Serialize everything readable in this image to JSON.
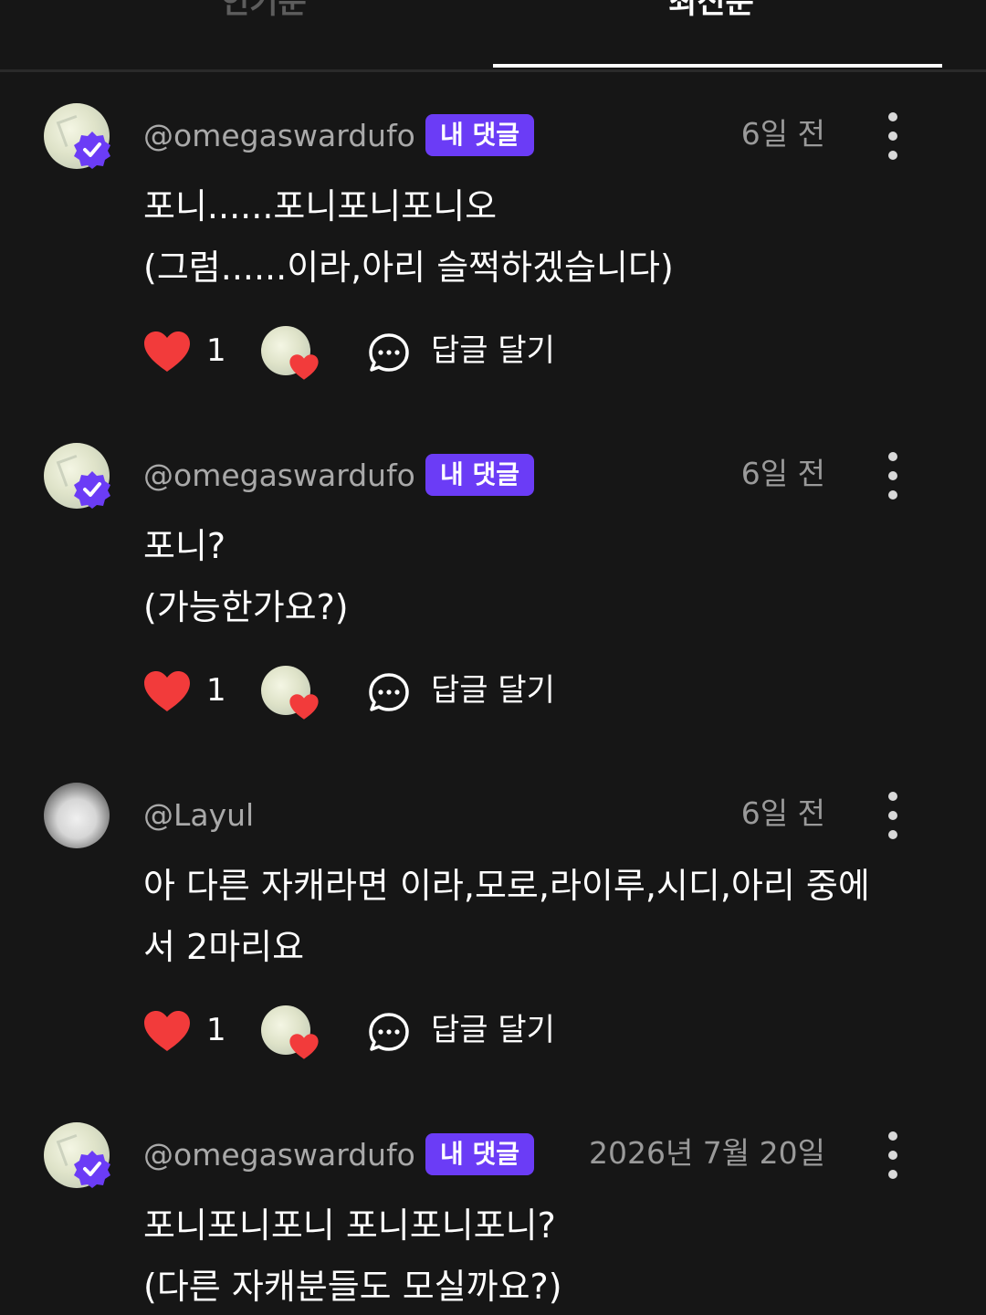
{
  "tabs": {
    "popular": "인기순",
    "latest": "최신순",
    "active": "latest"
  },
  "colors": {
    "background": "#161616",
    "badge": "#6b3cf6",
    "heart": "#f23b3b",
    "muted_text": "#a9a9a9"
  },
  "comments": [
    {
      "username": "@omegaswardufo",
      "badge": "내 댓글",
      "time": "6일 전",
      "lines": [
        "포니......포니포니포니오",
        "(그럼......이라,아리 슬쩍하겠습니다)"
      ],
      "likes": "1",
      "reply_label": "답글 달기",
      "avatar": "verified-user-avatar"
    },
    {
      "username": "@omegaswardufo",
      "badge": "내 댓글",
      "time": "6일 전",
      "lines": [
        "포니?",
        "(가능한가요?)"
      ],
      "likes": "1",
      "reply_label": "답글 달기",
      "avatar": "verified-user-avatar"
    },
    {
      "username": "@Layul",
      "badge": "",
      "time": "6일 전",
      "lines": [
        "아 다른 자캐라면 이라,모로,라이루,시디,아리 중에",
        "서 2마리요"
      ],
      "likes": "1",
      "reply_label": "답글 달기",
      "avatar": "husky-avatar"
    },
    {
      "username": "@omegaswardufo",
      "badge": "내 댓글",
      "time": "2026년 7월 20일",
      "lines": [
        "포니포니포니 포니포니포니?",
        "(다른 자캐분들도 모실까요?)"
      ],
      "likes": "",
      "reply_label": "",
      "avatar": "verified-user-avatar"
    }
  ]
}
